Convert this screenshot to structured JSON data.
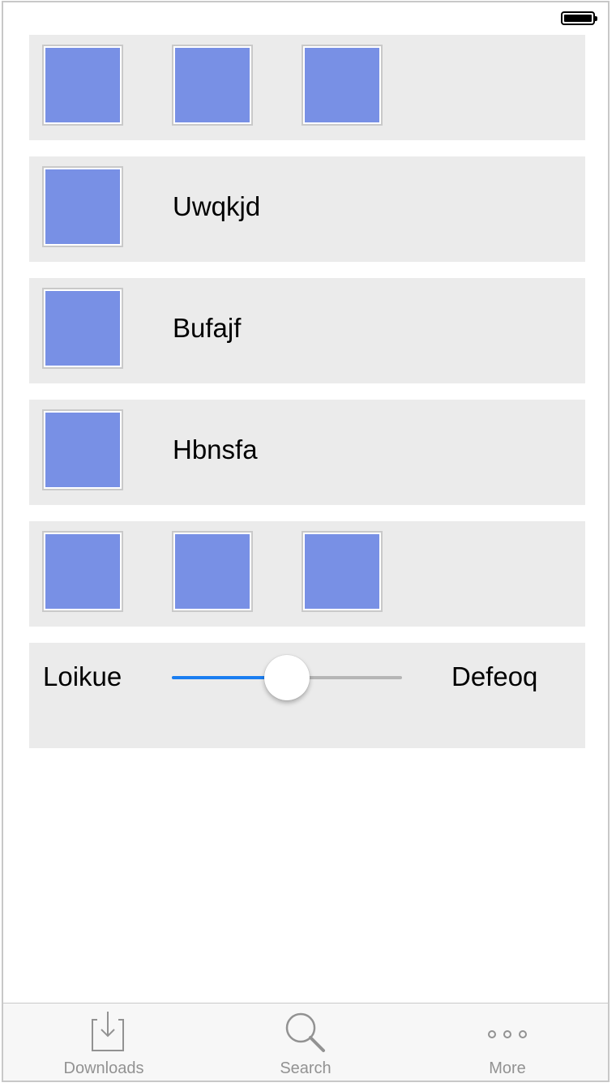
{
  "status_bar": {
    "battery_icon": "battery-full-icon"
  },
  "rows": [
    {
      "type": "images",
      "count": 3
    },
    {
      "type": "image-label",
      "label": "Uwqkjd"
    },
    {
      "type": "image-label",
      "label": "Bufajf"
    },
    {
      "type": "image-label",
      "label": "Hbnsfa"
    },
    {
      "type": "images",
      "count": 3
    },
    {
      "type": "slider",
      "min_label": "Loikue",
      "max_label": "Defeoq",
      "value": 0.5
    }
  ],
  "tab_bar": {
    "tabs": [
      {
        "label": "Downloads",
        "icon": "download-icon"
      },
      {
        "label": "Search",
        "icon": "search-icon"
      },
      {
        "label": "More",
        "icon": "more-icon"
      }
    ]
  },
  "colors": {
    "image_placeholder": "#7890e5",
    "slider_fill": "#1a7ef1",
    "row_background": "#ebebeb",
    "tab_label": "#929292"
  }
}
